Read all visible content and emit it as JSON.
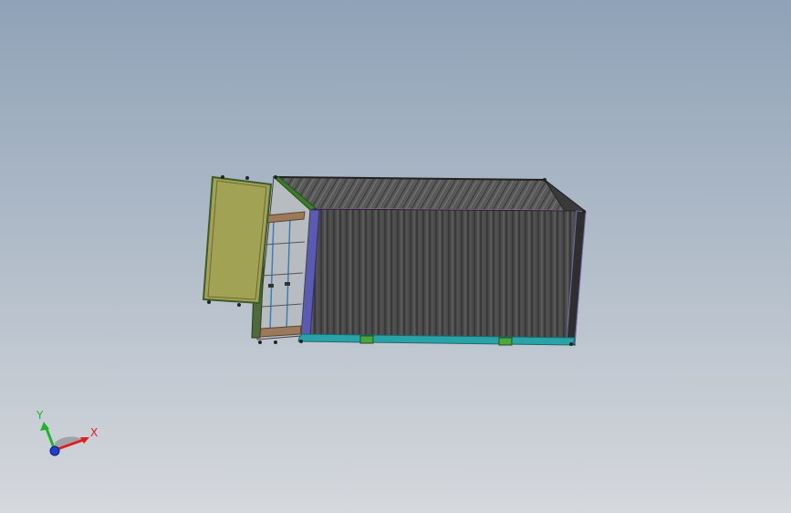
{
  "viewport": {
    "background_top": "#8fa2b7",
    "background_bottom": "#d5d8dc"
  },
  "model": {
    "body_color": "#4a4a4a",
    "rib_color": "#2e2e2e",
    "roof_color": "#585858",
    "door_color": "#a2a255",
    "door_frame_color": "#3d5b2a",
    "end_frame_color": "#b0b6bb",
    "bottom_rail_color": "#2aa3a8",
    "corner_post_color": "#6d6db0",
    "top_rail_color": "#b06bc0",
    "fitting_color": "#4ba63f",
    "wood_color": "#9a7a5a"
  },
  "triad": {
    "x_label": "X",
    "y_label": "Y",
    "x_color": "#e0201c",
    "y_color": "#1fb32a",
    "z_color": "#1f3fd0"
  }
}
